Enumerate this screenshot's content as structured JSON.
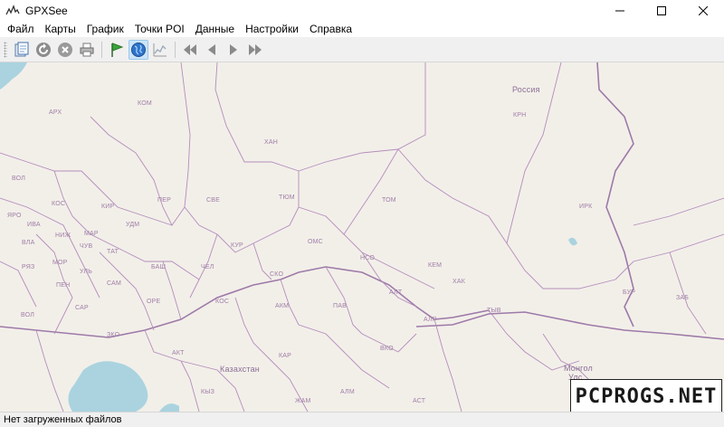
{
  "window": {
    "title": "GPXSee",
    "icon": "gpxsee-app-icon",
    "controls": [
      "minimize-icon",
      "maximize-icon",
      "close-icon"
    ]
  },
  "menu": {
    "file": "Файл",
    "maps": "Карты",
    "graph": "График",
    "poi": "Точки POI",
    "data": "Данные",
    "settings": "Настройки",
    "help": "Справка"
  },
  "toolbar": {
    "buttons": [
      {
        "name": "open-file-icon"
      },
      {
        "name": "reload-icon"
      },
      {
        "name": "close-file-icon"
      },
      {
        "name": "print-icon"
      },
      {
        "name": "poi-flag-icon"
      },
      {
        "name": "map-globe-icon",
        "active": true
      },
      {
        "name": "graph-icon"
      },
      {
        "name": "first-file-icon"
      },
      {
        "name": "previous-file-icon"
      },
      {
        "name": "next-file-icon"
      },
      {
        "name": "last-file-icon"
      }
    ]
  },
  "map": {
    "colors": {
      "land": "#f2efe9",
      "water": "#aad3df",
      "border": "#9e7aa8"
    },
    "labels": {
      "russia": "Россия",
      "krn": "КРН",
      "kom": "КОМ",
      "arh": "АРХ",
      "han": "ХАН",
      "vol": "ВОЛ",
      "kir": "КИР",
      "per": "ПЕР",
      "sve": "СВЕ",
      "tyum": "ТЮМ",
      "tom": "ТОМ",
      "irk": "ИРК",
      "yar": "ЯРО",
      "kos": "КОС",
      "iva": "ИВА",
      "niz": "НИЖ",
      "vla": "ВЛА",
      "mar": "МАР",
      "udm": "УДМ",
      "chu": "ЧУВ",
      "tat": "ТАТ",
      "ryaz": "РЯЗ",
      "mor": "МОР",
      "uly": "УЛЬ",
      "pen": "ПЕН",
      "sam": "САМ",
      "bash": "БАШ",
      "chel": "ЧЕЛ",
      "kur": "КУР",
      "oms": "ОМС",
      "nso": "НСО",
      "kem": "КЕМ",
      "sar": "САР",
      "ore": "ОРЕ",
      "kos2": "КОС",
      "sko": "СКО",
      "akm": "АКМ",
      "pav": "ПАВ",
      "alt": "АЛТ",
      "hak": "ХАК",
      "tyv": "ТЫВ",
      "bur": "БУР",
      "zab": "ЗАБ",
      "alr": "АЛР",
      "vol2": "ВОЛ",
      "zko": "ЗКО",
      "akt": "АКТ",
      "kar": "КАР",
      "vko": "ВКО",
      "kazakhstan": "Казахстан",
      "mongolia": "Монгол",
      "ulc": "Улс",
      "kyz": "КЫЗ",
      "zham": "ЖАМ",
      "alm": "АЛМ",
      "ast": "АСТ"
    }
  },
  "watermark": "PCPROGS.NET",
  "status": {
    "text": "Нет загруженных файлов"
  }
}
